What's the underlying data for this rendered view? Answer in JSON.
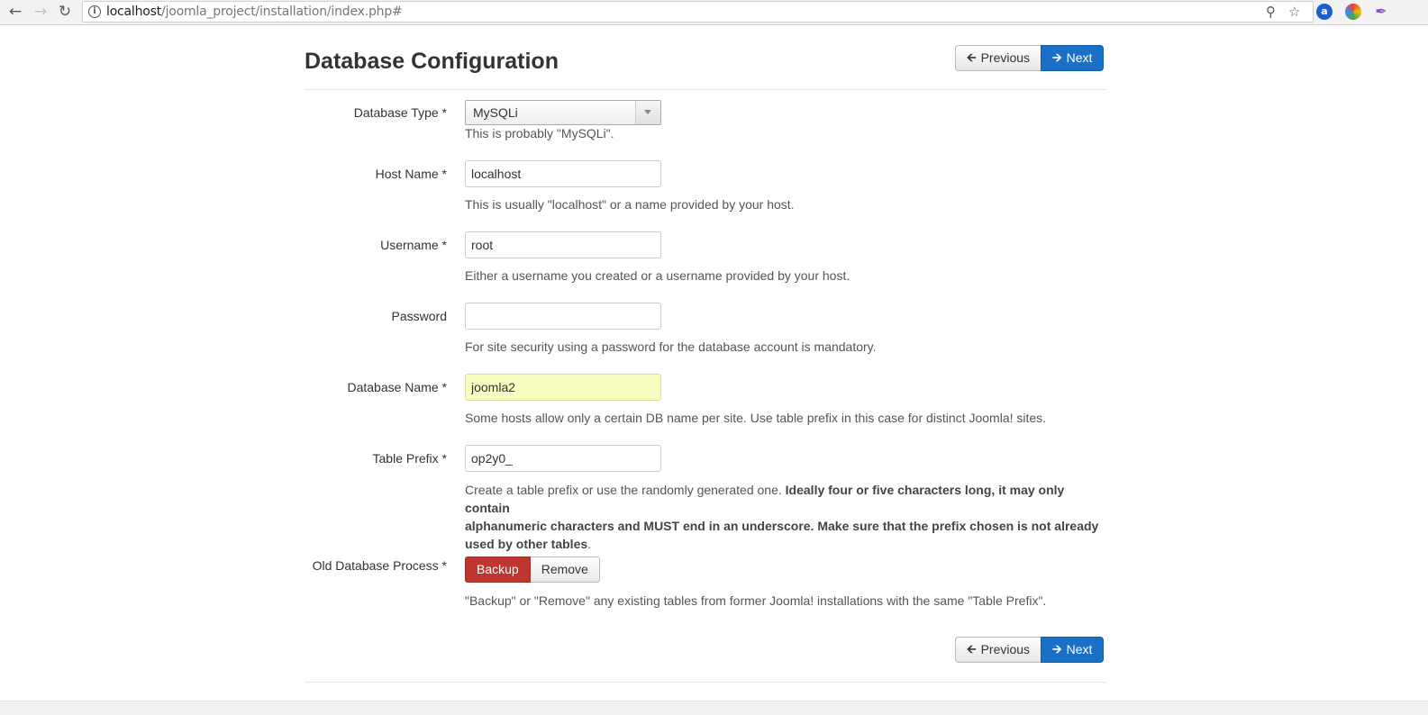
{
  "browser": {
    "url_host": "localhost",
    "url_path": "/joomla_project/installation/index.php#",
    "icons": [
      "back-icon",
      "forward-icon",
      "reload-icon",
      "info-icon",
      "key-icon",
      "star-icon"
    ]
  },
  "page": {
    "title": "Database Configuration"
  },
  "nav": {
    "previous_label": "Previous",
    "next_label": "Next"
  },
  "form": {
    "db_type": {
      "label": "Database Type *",
      "value": "MySQLi",
      "help": "This is probably \"MySQLi\"."
    },
    "host": {
      "label": "Host Name *",
      "value": "localhost",
      "help": "This is usually \"localhost\" or a name provided by your host."
    },
    "username": {
      "label": "Username *",
      "value": "root",
      "help": "Either a username you created or a username provided by your host."
    },
    "password": {
      "label": "Password",
      "value": "",
      "help": "For site security using a password for the database account is mandatory."
    },
    "db_name": {
      "label": "Database Name *",
      "value": "joomla2",
      "help": "Some hosts allow only a certain DB name per site. Use table prefix in this case for distinct Joomla! sites."
    },
    "prefix": {
      "label": "Table Prefix *",
      "value": "op2y0_",
      "help_plain": "Create a table prefix or use the randomly generated one. ",
      "help_bold_1": "Ideally four or five characters long, it may only contain",
      "help_bold_2": "alphanumeric characters and MUST end in an underscore. Make sure that the prefix chosen is not already",
      "help_bold_3": "used by other tables",
      "help_end": "."
    },
    "old_db": {
      "label": "Old Database Process *",
      "backup_label": "Backup",
      "remove_label": "Remove",
      "help": "\"Backup\" or \"Remove\" any existing tables from former Joomla! installations with the same \"Table Prefix\"."
    }
  },
  "colors": {
    "primary": "#1a6fc6",
    "danger": "#bd362f",
    "highlight": "#f9fcbf"
  }
}
